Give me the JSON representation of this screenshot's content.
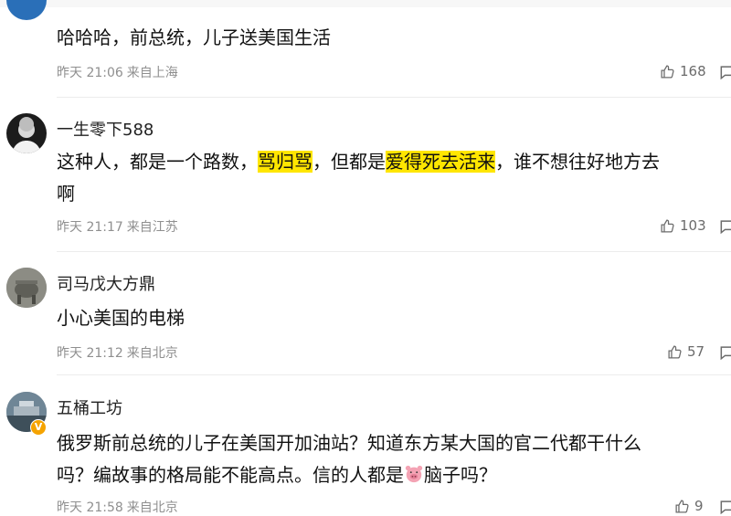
{
  "comments": [
    {
      "user": "",
      "text_parts": [
        "哈哈哈，前总统，儿子送美国生活"
      ],
      "time": "昨天 21:06",
      "location": "来自上海",
      "likes": "168"
    },
    {
      "user": "一生零下588",
      "text_line1": [
        "这种人，都是一个路数，",
        "骂归骂",
        "，但都是",
        "爱得死去活来",
        "，谁不想往好地方去"
      ],
      "text_line2": "啊",
      "time": "昨天 21:17",
      "location": "来自江苏",
      "likes": "103"
    },
    {
      "user": "司马戊大方鼎",
      "text": "小心美国的电梯",
      "time": "昨天 21:12",
      "location": "来自北京",
      "likes": "57"
    },
    {
      "user": "五桶工坊",
      "badge": "V",
      "text_line1": "俄罗斯前总统的儿子在美国开加油站？知道东方某大国的官二代都干什么",
      "text_line2_before": "吗？编故事的格局能不能高点。信的人都是",
      "emoji": "pig-face",
      "text_line2_after": "脑子吗？",
      "time": "昨天 21:58",
      "location": "来自北京",
      "likes": "9"
    }
  ],
  "colors": {
    "highlight": "#ffe600",
    "meta": "#8f8f8f",
    "divider": "#ececec"
  },
  "icons": [
    "thumbs-up-icon",
    "comment-bubble-icon",
    "pig-emoji"
  ]
}
